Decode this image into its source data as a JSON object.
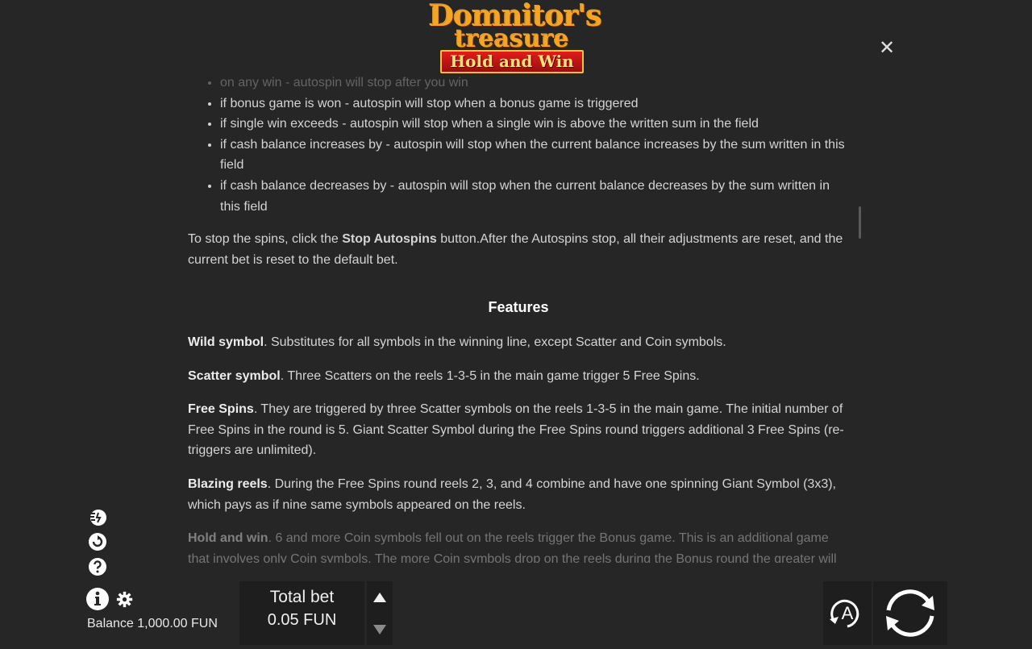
{
  "logo": {
    "line1": "Domnitor's",
    "line2": "treasure",
    "banner": "Hold and Win"
  },
  "close_icon": "close-icon",
  "autospin_bullets": [
    "on any win - autospin will stop after you win",
    "if bonus game is won - autospin will stop when a bonus game is triggered",
    "if single win exceeds - autospin will stop when a single win is above the written sum in the field",
    "if cash balance increases by - autospin will stop when the current balance increases by the sum written in this field",
    "if cash balance decreases by - autospin will stop when the current balance decreases by the sum written in this field"
  ],
  "stop_para": {
    "before": "To stop the spins, click the ",
    "bold": "Stop Autospins",
    "after": " button.After the Autospins stop, all their adjustments are reset, and the current bet is reset to the default bet."
  },
  "features_title": "Features",
  "features": [
    {
      "name": "Wild symbol",
      "text": ". Substitutes for all symbols in the winning line, except Scatter and Coin symbols."
    },
    {
      "name": "Scatter symbol",
      "text": ". Three Scatters on the reels 1-3-5 in the main game trigger 5 Free Spins."
    },
    {
      "name": "Free Spins",
      "text": ". They are triggered by three Scatter symbols on the reels 1-3-5 in the main game. The initial number of Free Spins in the round is 5. Giant Scatter Symbol during the Free Spins round triggers additional 3 Free Spins (re-triggers are unlimited)."
    },
    {
      "name": "Blazing reels",
      "text": ". During the Free Spins round reels 2, 3, and 4 combine and have one spinning Giant Symbol (3x3), which pays as if nine same symbols appeared on the reels."
    },
    {
      "name": "Hold and win",
      "text": ". 6 and more Coin symbols fell out on the reels trigger the Bonus game. This is an additional game that involves only Coin symbols. The more Coin symbols drop on the reels during the Bonus round the greater will"
    }
  ],
  "balance": {
    "label": "Balance",
    "value": "1,000.00 FUN"
  },
  "bet": {
    "label": "Total bet",
    "value": "0.05 FUN"
  },
  "auto_button_letter": "A",
  "colors": {
    "background": "#262626",
    "panel": "#1e1e1e",
    "text": "#d4d4d4",
    "logo_gold": "#f2a623",
    "logo_red": "#e21b1b"
  }
}
